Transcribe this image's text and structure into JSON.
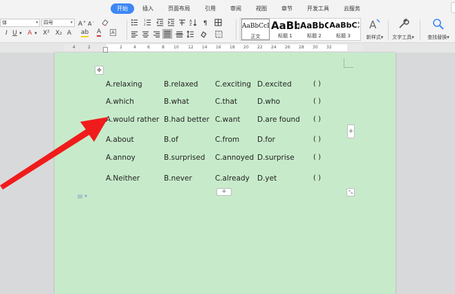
{
  "tabs": [
    "开始",
    "插入",
    "页面布局",
    "引用",
    "审阅",
    "视图",
    "章节",
    "开发工具",
    "云服务"
  ],
  "active_tab": "开始",
  "ribbon": {
    "font_name": "体",
    "font_size": "四号",
    "styles": [
      {
        "preview": "AaBbCcI",
        "name": "正文"
      },
      {
        "preview": "AaBb",
        "name": "标题 1"
      },
      {
        "preview": "AaBbC",
        "name": "标题 2"
      },
      {
        "preview": "AaBbC",
        "name": "标题 3"
      }
    ],
    "new_style": "新样式",
    "text_tools": "文字工具",
    "find_replace": "查找替换"
  },
  "ruler_numbers": [
    "4",
    "2",
    "2",
    "4",
    "6",
    "8",
    "10",
    "12",
    "14",
    "16",
    "18",
    "20",
    "22",
    "24",
    "26",
    "28",
    "30",
    "32"
  ],
  "questions": [
    {
      "a": "A.relaxing",
      "b": "B.relaxed",
      "c": "C.exciting",
      "d": "D.excited",
      "answer": "(      )"
    },
    {
      "a": "A.which",
      "b": "B.what",
      "c": "C.that",
      "d": "D.who",
      "answer": "(      )"
    },
    {
      "a": "A.would  rather",
      "b": "B.had  better",
      "c": "C.want",
      "d": "D.are  found",
      "answer": "(      )"
    },
    {
      "a": "A.about",
      "b": "B.of",
      "c": "C.from",
      "d": "D.for",
      "answer": "(      )"
    },
    {
      "a": "A.annoy",
      "b": "B.surprised",
      "c": "C.annoyed",
      "d": "D.surprise",
      "answer": "(      )"
    },
    {
      "a": "A.Neither",
      "b": "B.never",
      "c": "C.already",
      "d": "D.yet",
      "answer": "(      )"
    }
  ],
  "table_handles": {
    "add_row": "+",
    "add_col": "+"
  },
  "colors": {
    "accent": "#3d87f5",
    "page": "#c7ebca",
    "arrow": "#f01c1c"
  }
}
